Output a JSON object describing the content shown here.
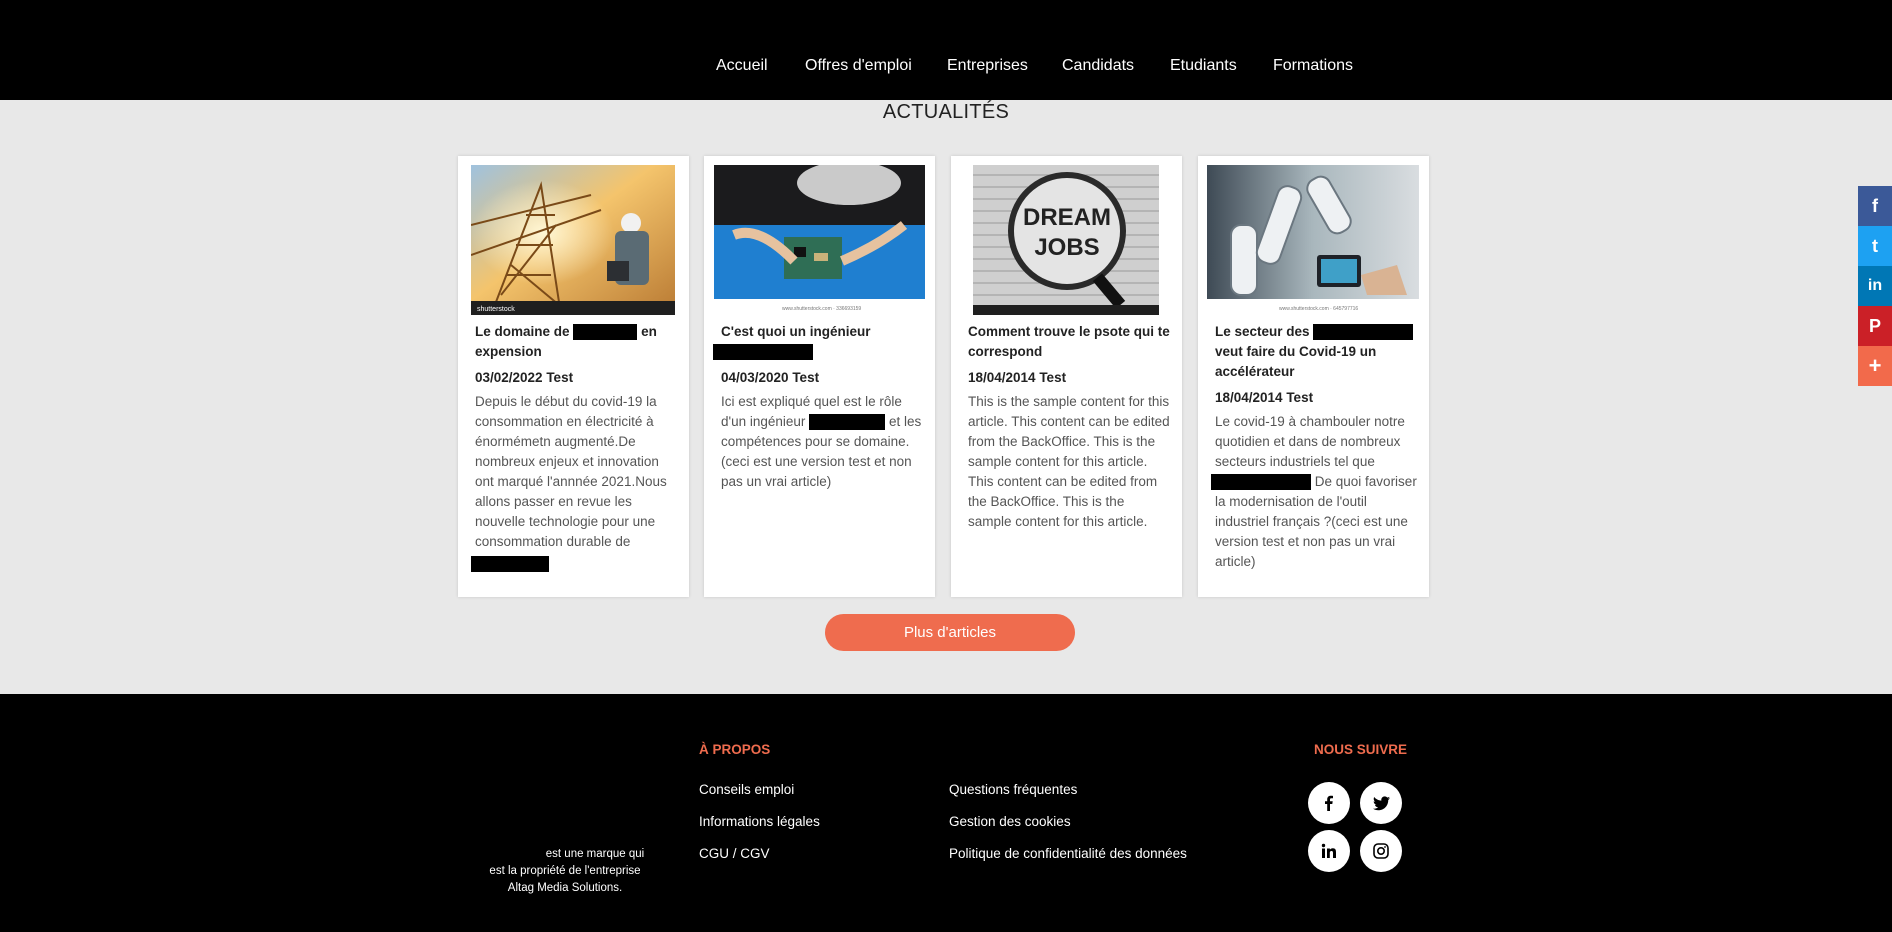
{
  "nav": {
    "items": [
      "Accueil",
      "Offres d'emploi",
      "Entreprises",
      "Candidats",
      "Etudiants",
      "Formations"
    ]
  },
  "section": {
    "title": "ACTUALITÉS"
  },
  "cards": [
    {
      "title_a": "Le domaine de",
      "title_b": "en expension",
      "date": "03/02/2022 Test",
      "excerpt": "Depuis le début du covid-19 la consommation en électricité à énormémetn augmenté.De nombreux enjeux et innovation ont marqué l'annnée 2021.Nous allons passer en revue les nouvelle technologie pour une consommation durable de",
      "image": "power-engineer"
    },
    {
      "title_a": "C'est quoi un ingénieur",
      "date": "04/03/2020 Test",
      "excerpt_a": "Ici est expliqué quel est le rôle d'un ingénieur",
      "excerpt_b": "et les compétences pour se domaine. (ceci est une version test et non pas un vrai article)",
      "image": "circuit-board"
    },
    {
      "title": "Comment trouve le psote qui te correspond",
      "date": "18/04/2014 Test",
      "excerpt": "This is the sample content for this article. This content can be edited from the BackOffice. This is the sample content for this article. This content can be edited from the BackOffice. This is the sample content for this article.",
      "image": "dream-jobs",
      "image_text_1": "DREAM",
      "image_text_2": "JOBS"
    },
    {
      "title_a": "Le secteur des",
      "title_b": "veut faire du Covid-19 un accélérateur",
      "date": "18/04/2014 Test",
      "excerpt_a": "Le covid-19 à chambouler notre quotidien et dans de nombreux secteurs industriels tel que",
      "excerpt_b": "De quoi favoriser la modernisation de l'outil industriel français ?(ceci est une version test et non pas un vrai article)",
      "image": "industrial-robot"
    }
  ],
  "more_button": "Plus d'articles",
  "share": [
    {
      "icon": "facebook-icon",
      "glyph": "f",
      "color": "#3b5998"
    },
    {
      "icon": "twitter-icon",
      "glyph": "t",
      "color": "#1da1f2"
    },
    {
      "icon": "linkedin-icon",
      "glyph": "in",
      "color": "#0077b5"
    },
    {
      "icon": "pinterest-icon",
      "glyph": "P",
      "color": "#cb2027"
    },
    {
      "icon": "plus-icon",
      "glyph": "+",
      "color": "#f26a4b"
    }
  ],
  "footer": {
    "apropos_heading": "À PROPOS",
    "follow_heading": "NOUS SUIVRE",
    "links_col1": [
      "Conseils emploi",
      "Informations légales",
      "CGU / CGV"
    ],
    "links_col2": [
      "Questions fréquentes",
      "Gestion des cookies",
      "Politique de confidentialité des données"
    ],
    "brand_line1": "est une marque qui",
    "brand_line2": "est la propriété de l'entreprise",
    "brand_line3": "Altag Media Solutions."
  },
  "colors": {
    "accent": "#ef6c4e",
    "header": "#000000",
    "background": "#e8e8e8"
  }
}
